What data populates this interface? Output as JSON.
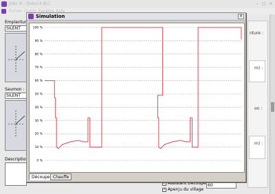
{
  "main_window": {
    "title": "Jobs III - [Jobs14.8c]",
    "menu": [
      "Fichier",
      "Outils",
      "Fenêtre",
      "Aide"
    ]
  },
  "left_panel": {
    "emplanture_label": "Emplanture :",
    "emplanture_value": "SILENT",
    "saumon_label": "Saumon :",
    "saumon_value": "SILENT",
    "description_label": "Description :"
  },
  "right_panel": {
    "label_1": "nture :",
    "label_2": "m) :",
    "label_3": "on :",
    "label_4": "m) :"
  },
  "checkboxes": [
    {
      "label": "Assistant Découpe",
      "checked": true
    },
    {
      "label": "Aperçu du village",
      "checked": true
    }
  ],
  "aperçu_value": "60",
  "dialog": {
    "title": "Simulation",
    "close": "×",
    "tabs": [
      "Découpe",
      "Chauffe"
    ],
    "active_tab": "Découpe"
  },
  "chart_data": {
    "type": "line",
    "ylim": [
      0,
      100
    ],
    "yticks": [
      "0 %",
      "10 %",
      "20 %",
      "30 %",
      "40 %",
      "50 %",
      "60 %",
      "70 %",
      "80 %",
      "90 %",
      "100 %"
    ],
    "grid": true,
    "series": [
      {
        "color": "#e8454f",
        "x": [
          0,
          5,
          5,
          5.5,
          5.5,
          6,
          6,
          7,
          9,
          13,
          17,
          20,
          22,
          22,
          23,
          23,
          29,
          29,
          60,
          60,
          57.5,
          57.5,
          58,
          58,
          59,
          61,
          65,
          69,
          72,
          74,
          74,
          75,
          75,
          78,
          78,
          100,
          100
        ],
        "y": [
          60,
          60,
          47,
          47,
          32,
          32,
          10,
          9,
          12,
          14,
          15,
          14,
          14,
          32,
          32,
          10,
          10,
          100,
          100,
          49,
          49,
          32,
          32,
          10,
          9,
          12,
          14,
          15,
          14,
          14,
          32,
          32,
          10,
          10,
          100,
          100,
          91
        ]
      }
    ]
  }
}
